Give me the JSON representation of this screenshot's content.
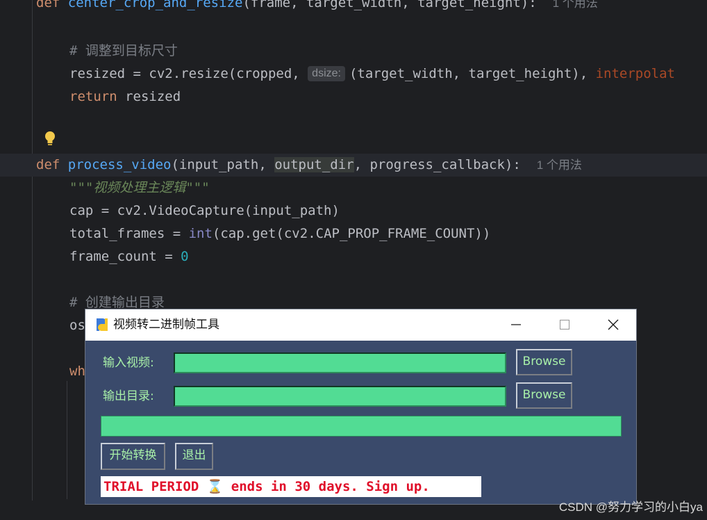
{
  "editor": {
    "line1": {
      "def": "def ",
      "fn": "center_crop_and_resize",
      "rest": "(frame, target_width, target_height):",
      "usage": "1 个用法"
    },
    "line3": {
      "comment": "# 调整到目标尺寸"
    },
    "line4": {
      "pre": "resized = cv2.resize(cropped, ",
      "hint": "dsize:",
      "mid": "(target_width, target_height), ",
      "param": "interpolat"
    },
    "line5": {
      "kw": "return",
      "rest": " resized"
    },
    "line7": {
      "def": "def ",
      "fn": "process_video",
      "a": "(input_path, ",
      "hl": "output_dir",
      "b": ", progress_callback):",
      "usage": "1 个用法"
    },
    "line8": {
      "doc": "\"\"\"视频处理主逻辑\"\"\""
    },
    "line9": {
      "text": "cap = cv2.VideoCapture(input_path)"
    },
    "line10": {
      "a": "total_frames = ",
      "bi": "int",
      "b": "(cap.get(cv2.CAP_PROP_FRAME_COUNT))"
    },
    "line11": {
      "a": "frame_count = ",
      "num": "0"
    },
    "line13": {
      "comment": "# 创建输出目录"
    },
    "line14": {
      "text": "os"
    },
    "line16": {
      "kw": "wh"
    }
  },
  "watermark": "CSDN @努力学习的小白ya",
  "window": {
    "title": "视频转二进制帧工具",
    "input_label": "输入视频:",
    "input_value": "",
    "output_label": "输出目录:",
    "output_value": "",
    "browse1": "Browse",
    "browse2": "Browse",
    "progress": 0,
    "start_button": "开始转换",
    "exit_button": "退出",
    "trial_text": "TRIAL PERIOD ⌛ ends in 30 days. Sign up."
  },
  "colors": {
    "editor_bg": "#1e1f22",
    "window_bg": "#3a4a6b",
    "entry_bg": "#52dc94",
    "label_fg": "#a8f0a8",
    "trial_fg": "#e0102a"
  }
}
